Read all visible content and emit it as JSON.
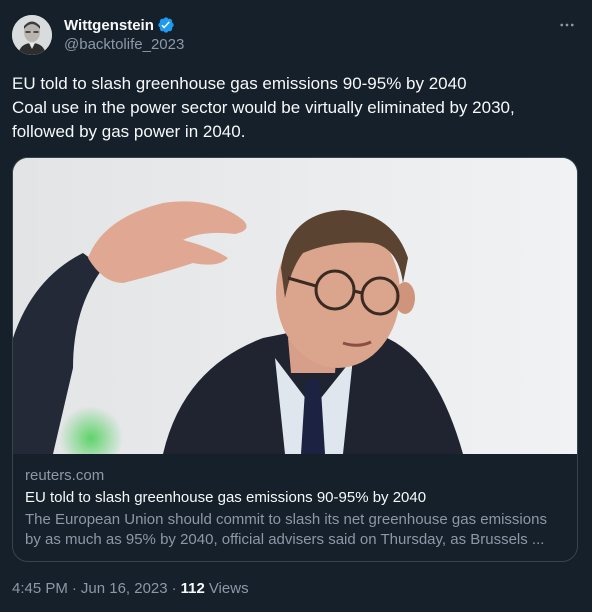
{
  "author": {
    "display_name": "Wittgenstein",
    "handle": "@backtolife_2023",
    "verified": true
  },
  "tweet": {
    "lines": [
      "EU told to slash greenhouse gas emissions 90-95% by 2040",
      "Coal use in the power sector would be virtually eliminated by 2030,",
      "followed by gas power in 2040."
    ]
  },
  "card": {
    "domain": "reuters.com",
    "title": "EU told to slash greenhouse gas emissions 90-95% by 2040",
    "description_lines": [
      "The European Union should commit to slash its net greenhouse gas emissions",
      "by as much as 95% by 2040, official advisers said on Thursday, as Brussels ..."
    ]
  },
  "footer": {
    "time": "4:45 PM",
    "separator": "·",
    "date": "Jun 16, 2023",
    "views_count": "112",
    "views_label": "Views"
  },
  "colors": {
    "background": "#15202b",
    "verified_blue": "#1d9bf0",
    "secondary_text": "#8b98a5",
    "border": "#38444d"
  },
  "icons": {
    "more": "more-horizontal-icon",
    "verified": "verified-badge-icon"
  }
}
